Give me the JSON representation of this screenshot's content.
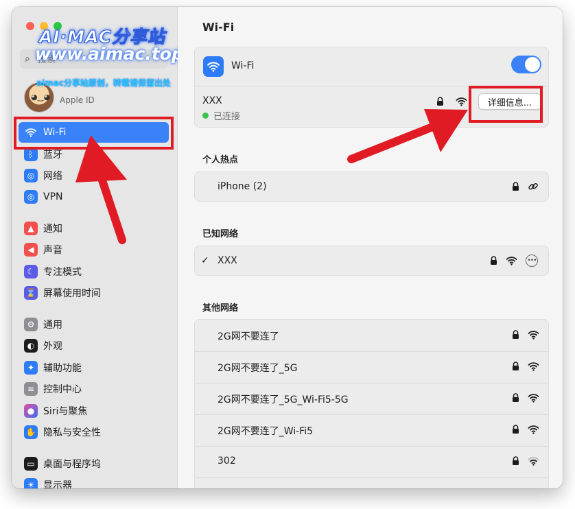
{
  "window": {
    "title": "Wi-Fi"
  },
  "watermark": {
    "title": "AI·MAC分享站",
    "url": "www.aimac.top",
    "note": "aimac分享站原创，转载请保留出处"
  },
  "sidebar": {
    "search": {
      "placeholder": "搜索"
    },
    "profile": {
      "subtitle": "Apple ID"
    },
    "items": [
      {
        "label": "Wi-Fi",
        "icon": "wifi-icon",
        "color": "#3a82f7"
      },
      {
        "label": "蓝牙",
        "icon": "bluetooth-icon",
        "color": "#2d7cf6"
      },
      {
        "label": "网络",
        "icon": "globe-icon",
        "color": "#2d7cf6"
      },
      {
        "label": "VPN",
        "icon": "vpn-globe-icon",
        "color": "#2d7cf6"
      },
      {
        "label": "通知",
        "icon": "bell-icon",
        "color": "#f2504f"
      },
      {
        "label": "声音",
        "icon": "speaker-icon",
        "color": "#f2504f"
      },
      {
        "label": "专注模式",
        "icon": "moon-icon",
        "color": "#5b5be6"
      },
      {
        "label": "屏幕使用时间",
        "icon": "hourglass-icon",
        "color": "#5b5be6"
      },
      {
        "label": "通用",
        "icon": "gear-icon",
        "color": "#8e8e93"
      },
      {
        "label": "外观",
        "icon": "appearance-icon",
        "color": "#1c1c1c"
      },
      {
        "label": "辅助功能",
        "icon": "accessibility-icon",
        "color": "#2d7cf6"
      },
      {
        "label": "控制中心",
        "icon": "control-center-icon",
        "color": "#8e8e93"
      },
      {
        "label": "Siri与聚焦",
        "icon": "siri-icon",
        "color": "#7a3fd6"
      },
      {
        "label": "隐私与安全性",
        "icon": "hand-icon",
        "color": "#2d7cf6"
      },
      {
        "label": "桌面与程序坞",
        "icon": "dock-icon",
        "color": "#1c1c1c"
      },
      {
        "label": "显示器",
        "icon": "sun-icon",
        "color": "#2d7cf6"
      }
    ]
  },
  "main": {
    "title": "Wi-Fi",
    "wifi_label": "Wi-Fi",
    "wifi_enabled": true,
    "current": {
      "name": "XXX",
      "status": "已连接",
      "details_button": "详细信息..."
    },
    "hotspot": {
      "title": "个人热点",
      "name": "iPhone (2)"
    },
    "known": {
      "title": "已知网络",
      "name": "XXX"
    },
    "other": {
      "title": "其他网络",
      "networks": [
        {
          "name": "2G网不要连了"
        },
        {
          "name": "2G网不要连了_5G"
        },
        {
          "name": "2G网不要连了_5G_Wi-Fi5-5G"
        },
        {
          "name": "2G网不要连了_Wi-Fi5"
        },
        {
          "name": "302"
        }
      ]
    }
  },
  "accent_color": "#3b82f7",
  "annotation_color": "#e01b24"
}
